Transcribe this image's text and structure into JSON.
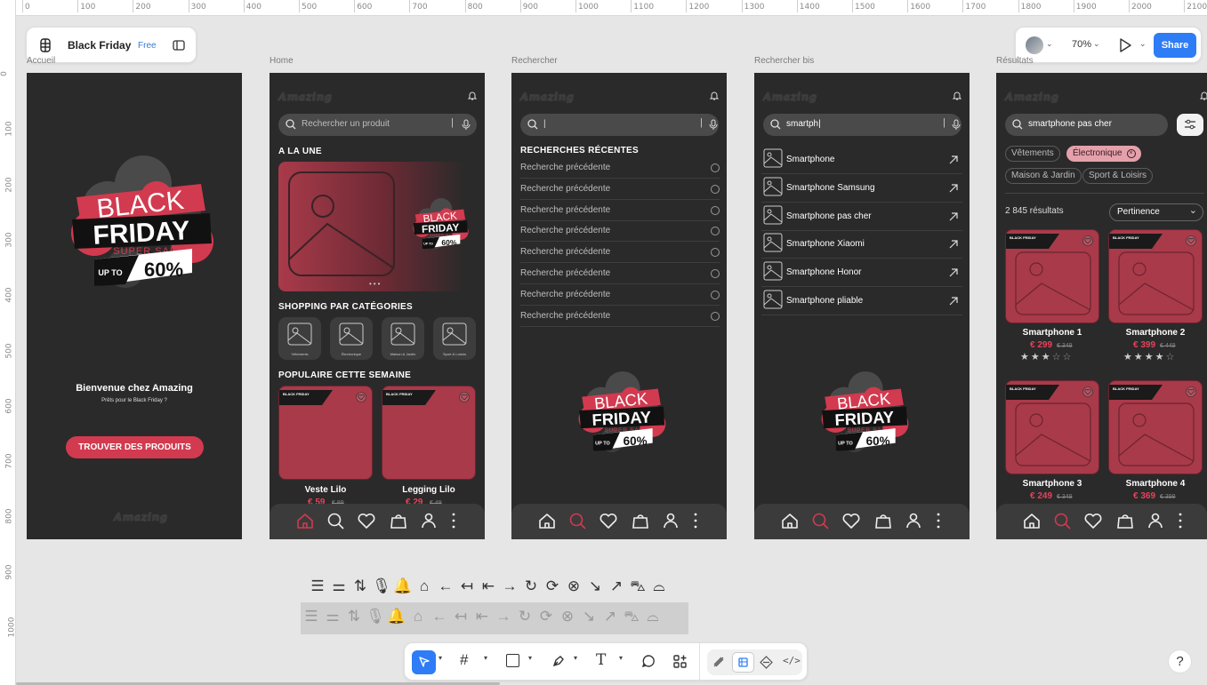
{
  "ruler": {
    "top_ticks": [
      "0",
      "100",
      "200",
      "300",
      "400",
      "500",
      "600",
      "700",
      "800",
      "900",
      "1000",
      "1100",
      "1200",
      "1300",
      "1400",
      "1500",
      "1600",
      "1700",
      "1800",
      "1900",
      "2000",
      "2100"
    ],
    "left_ticks": [
      "0",
      "100",
      "200",
      "300",
      "400",
      "500",
      "600",
      "700",
      "800",
      "900",
      "1000"
    ]
  },
  "file": {
    "name": "Black Friday",
    "plan": "Free"
  },
  "toolbar_right": {
    "zoom": "70%",
    "share_label": "Share"
  },
  "frames": {
    "accueil": {
      "label": "Accueil",
      "welcome_title": "Bienvenue chez Amazing",
      "welcome_sub": "Prêts pour le Black Friday ?",
      "cta": "TROUVER DES PRODUITS",
      "footer_logo": "Amazing"
    },
    "home": {
      "label": "Home",
      "logo": "Amazing",
      "search_placeholder": "Rechercher un produit",
      "section_une": "A LA UNE",
      "section_categories": "SHOPPING PAR CATÉGORIES",
      "categories": [
        "Vêtements",
        "Électronique",
        "Maison & Jardin",
        "Sport & Loisirs"
      ],
      "section_popular": "POPULAIRE CETTE SEMAINE",
      "products": [
        {
          "name": "Veste Lilo",
          "price": "€ 59",
          "old": "€ 89"
        },
        {
          "name": "Legging Lilo",
          "price": "€ 29",
          "old": "€ 49"
        }
      ]
    },
    "rechercher": {
      "label": "Rechercher",
      "logo": "Amazing",
      "search_value": "|",
      "recent_title": "RECHERCHES RÉCENTES",
      "recent": [
        "Recherche précédente",
        "Recherche précédente",
        "Recherche précédente",
        "Recherche précédente",
        "Recherche précédente",
        "Recherche précédente",
        "Recherche précédente",
        "Recherche précédente"
      ]
    },
    "rechercher_bis": {
      "label": "Rechercher bis",
      "logo": "Amazing",
      "search_value": "smartph|",
      "suggestions": [
        "Smartphone",
        "Smartphone Samsung",
        "Smartphone pas cher",
        "Smartphone Xiaomi",
        "Smartphone Honor",
        "Smartphone pliable"
      ]
    },
    "resultats": {
      "label": "Résultats",
      "logo": "Amazing",
      "search_value": "smartphone pas cher",
      "filters": [
        "Vêtements",
        "Électronique",
        "Maison & Jardin",
        "Sport & Loisirs"
      ],
      "count": "2 845 résultats",
      "sort": "Pertinence",
      "products": [
        {
          "name": "Smartphone 1",
          "price": "€ 299",
          "old": "€ 349",
          "rating": 3
        },
        {
          "name": "Smartphone 2",
          "price": "€ 399",
          "old": "€ 449",
          "rating": 4
        },
        {
          "name": "Smartphone 3",
          "price": "€ 249",
          "old": "€ 349",
          "rating": 0
        },
        {
          "name": "Smartphone 4",
          "price": "€ 369",
          "old": "€ 399",
          "rating": 0
        }
      ]
    }
  },
  "badge": {
    "black": "BLACK",
    "friday": "FRIDAY",
    "super": "SUPER SALES",
    "upto": "UP TO",
    "pct": "60%"
  },
  "product_badge": {
    "line1": "BLACK FRIDAY",
    "line2": "SUPER SALES"
  },
  "icon_strip": [
    "menu-icon",
    "sliders-icon",
    "sort-icon",
    "mic-icon",
    "bell-icon",
    "tag-icon",
    "arrow-left-icon",
    "arrow-left-bar-icon",
    "arrow-left-end-icon",
    "arrow-right-icon",
    "refresh-icon",
    "refresh-alt-icon",
    "close-circle-icon",
    "arrow-down-right-icon",
    "arrow-up-right-icon",
    "bag-alert-icon",
    "bag-icon"
  ],
  "colors": {
    "accent": "#d23a4f",
    "frame_bg": "#2a2a2a",
    "card": "#a93a4a",
    "share": "#2e7cf6"
  },
  "help": "?"
}
